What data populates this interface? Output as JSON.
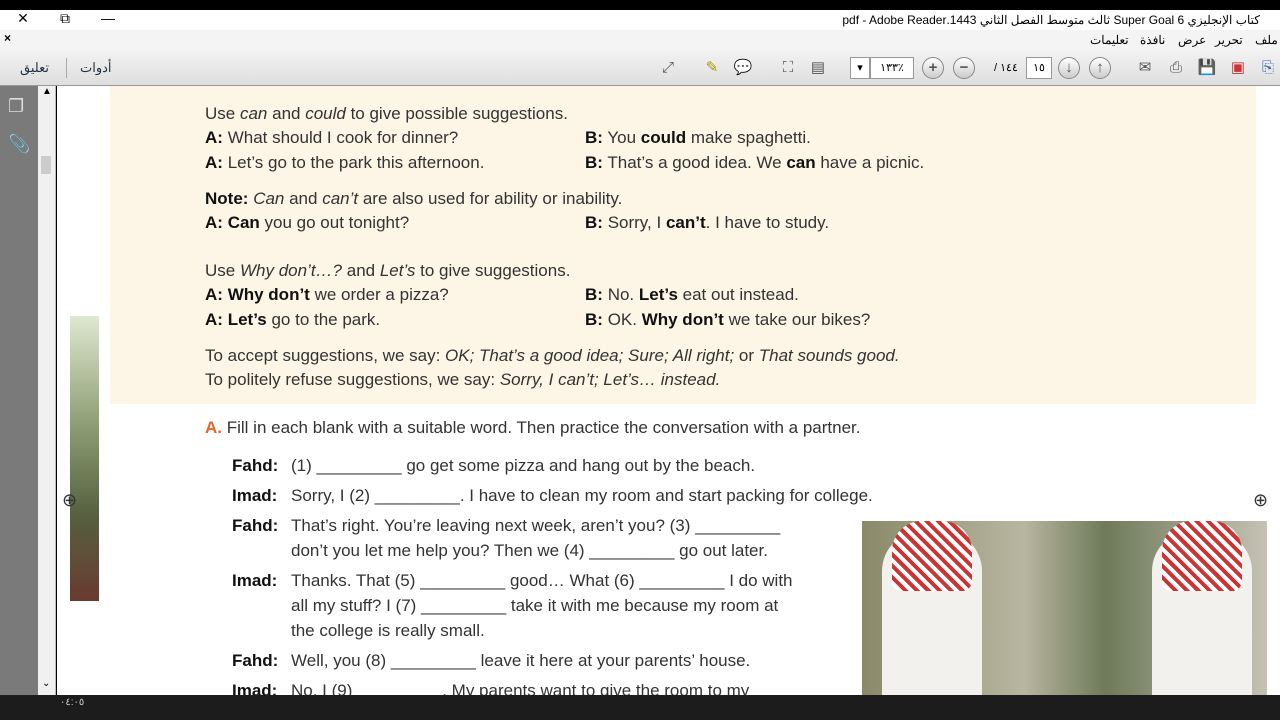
{
  "window": {
    "title": "كتاب الإنجليزي Super Goal 6 ثالث متوسط الفصل الثاني 1443.pdf - Adobe Reader",
    "close": "✕",
    "restore": "⧉",
    "minimize": "—",
    "doc_close": "×"
  },
  "menu": [
    "ملف",
    "تحرير",
    "عرض",
    "نافذة",
    "تعليمات"
  ],
  "toolbar": {
    "comment": "تعليق",
    "tools": "أدوات",
    "zoom": "١٣٣٪",
    "page_current": "١٥",
    "page_total": "/ ١٤٤"
  },
  "content": {
    "l1": [
      "Use ",
      "can",
      " and ",
      "could",
      " to give possible suggestions."
    ],
    "ex1": {
      "a": "What should I cook for dinner?",
      "b1": "You ",
      "b2": "could",
      "b3": " make spaghetti."
    },
    "ex2": {
      "a": "Let’s go to the park this afternoon.",
      "b1": "That’s a good idea. We ",
      "b2": "can",
      "b3": " have a picnic."
    },
    "note": {
      "label": "Note:",
      "t1": "Can",
      "t2": " and ",
      "t3": "can’t",
      "t4": " are also used for ability or inability."
    },
    "ex3": {
      "a1": "Can",
      "a2": " you go out tonight?",
      "b1": "Sorry, I ",
      "b2": "can’t",
      ".": "",
      "b3": ". I have to study."
    },
    "l2": [
      "Use ",
      "Why don’t…?",
      " and ",
      "Let’s",
      " to give suggestions."
    ],
    "ex4": {
      "a1": "Why don’t",
      "a2": " we order a pizza?",
      "b1": "No. ",
      "b2": "Let’s",
      "b3": " eat out instead."
    },
    "ex5": {
      "a1": "Let’s",
      "a2": " go to the park.",
      "b1": "OK. ",
      "b2": "Why don’t",
      "b3": " we take our bikes?"
    },
    "accept": {
      "t": "To accept suggestions, we say: ",
      "i": "OK; That’s a good idea; Sure; All right;",
      "o": " or ",
      "i2": "That sounds good."
    },
    "refuse": {
      "t": "To politely refuse suggestions, we say: ",
      "i": "Sorry, I can’t; Let’s… instead."
    },
    "A_label": "A.",
    "A_text": "Fill in each blank with a suitable word. Then practice the conversation with a partner.",
    "A_label_speaker": "A:",
    "B_label_speaker": "B:",
    "dialog": [
      {
        "s": "Fahd:",
        "lines": [
          "(1) _________ go get some pizza and hang out by the beach."
        ]
      },
      {
        "s": "Imad:",
        "lines": [
          "Sorry, I (2) _________. I have to clean my room and start packing for college."
        ]
      },
      {
        "s": "Fahd:",
        "lines": [
          "That’s right. You’re leaving next week, aren’t you? (3) _________",
          "don’t you let me help you? Then we (4) _________ go out later."
        ]
      },
      {
        "s": "Imad:",
        "lines": [
          "Thanks. That (5) _________ good… What (6) _________ I do with",
          "all my stuff? I (7) _________ take it with me because my room at",
          "the college is really small."
        ]
      },
      {
        "s": "Fahd:",
        "lines": [
          "Well, you (8) _________ leave it here at your parents’ house."
        ]
      },
      {
        "s": "Imad:",
        "lines": [
          "No, I (9) _________. My parents want to give the room to my"
        ]
      }
    ]
  },
  "taskbar": {
    "time": "٠٤:٠٥"
  }
}
